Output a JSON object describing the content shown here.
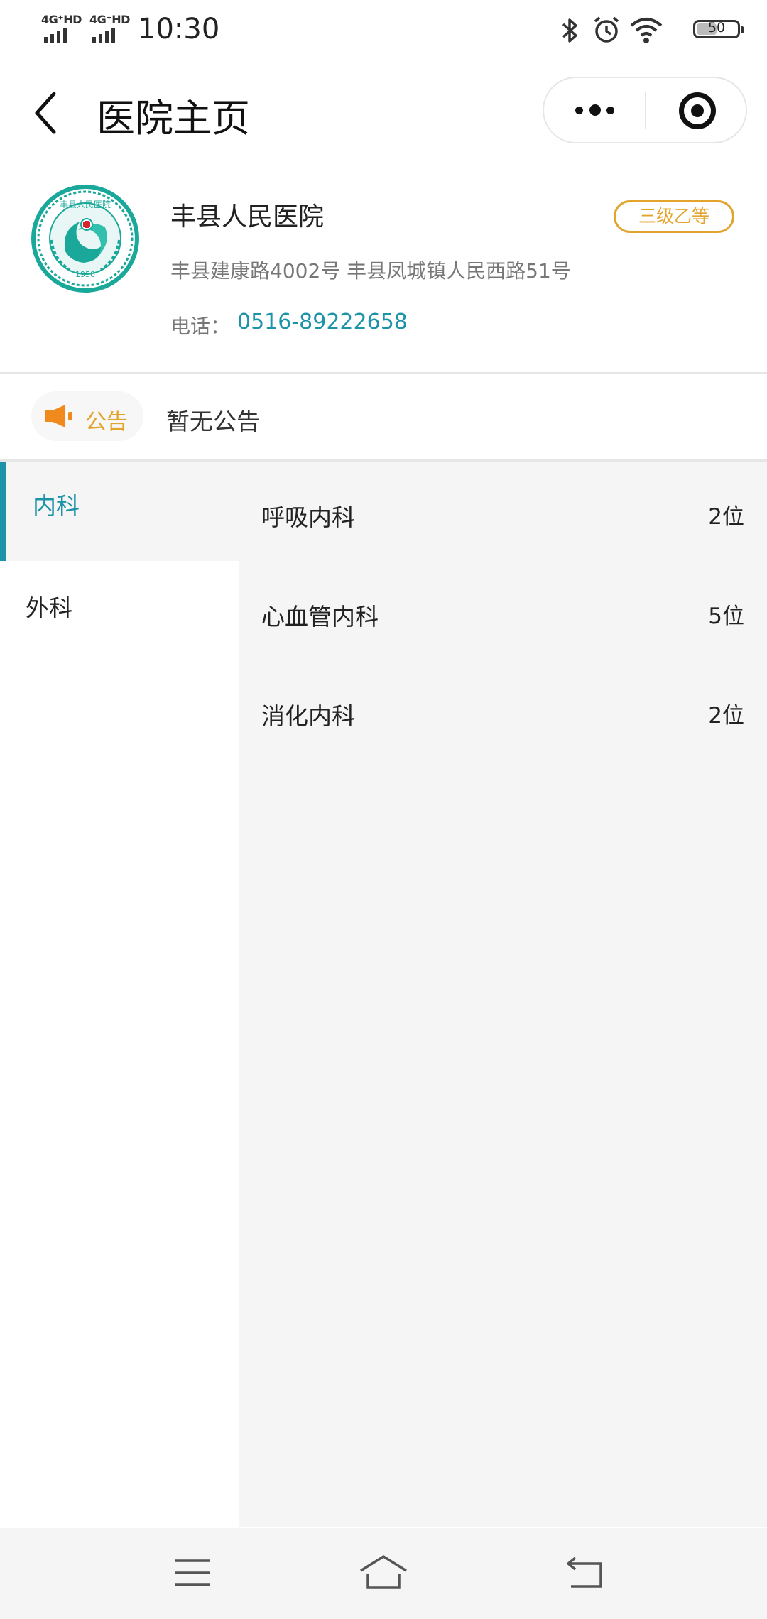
{
  "status_bar": {
    "network1": "4G⁺HD",
    "network2": "4G⁺HD",
    "time": "10:30",
    "battery": "50",
    "icons": [
      "bluetooth-icon",
      "alarm-icon",
      "wifi-icon",
      "battery-icon"
    ]
  },
  "nav": {
    "title": "医院主页",
    "back_icon": "chevron-left-icon",
    "more_icon": "more-dots-icon",
    "close_icon": "target-circle-icon"
  },
  "hospital": {
    "name": "丰县人民医院",
    "grade": "三级乙等",
    "address": "丰县建康路4002号 丰县凤城镇人民西路51号",
    "phone_label": "电话：",
    "phone": "0516-89222658",
    "logo_text": "丰县人民医院",
    "logo_year": "1950"
  },
  "notice": {
    "label": "公告",
    "text": "暂无公告",
    "icon": "speaker-icon"
  },
  "categories": [
    {
      "label": "内科",
      "active": true
    },
    {
      "label": "外科",
      "active": false
    }
  ],
  "departments": [
    {
      "name": "呼吸内科",
      "count": "2位"
    },
    {
      "name": "心血管内科",
      "count": "5位"
    },
    {
      "name": "消化内科",
      "count": "2位"
    }
  ],
  "colors": {
    "accent": "#1d93a8",
    "grade": "#e3a42d",
    "notice_orange": "#f08a1c",
    "logo_green": "#1aa89a"
  },
  "system_nav": [
    "menu-icon",
    "home-icon",
    "back-icon"
  ]
}
